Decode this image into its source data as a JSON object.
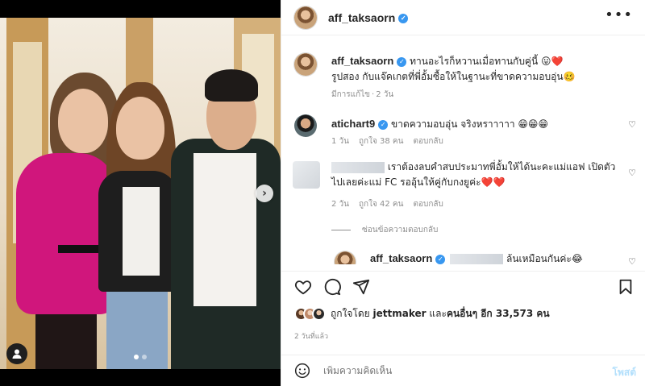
{
  "post": {
    "username": "aff_taksaorn",
    "more_icon": "more-horizontal-icon"
  },
  "caption": {
    "username": "aff_taksaorn",
    "line1": "ทานอะไรก็หวานเมื่อทานกับคู่นี้ 😛❤️",
    "line2": "รูปสอง กับแจ๊คเกตที่พี่อั้มซื้อให้ในฐานะที่ขาดความอบอุ่น🥴",
    "edited": "มีการแก้ไข",
    "time": "2 วัน"
  },
  "comments": [
    {
      "username": "atichart9",
      "text": "ขาดความอบอุ่น จริงหราาาาา 😁😁😁",
      "time": "1 วัน",
      "likes": "ถูกใจ 38 คน",
      "reply": "ตอบกลับ"
    },
    {
      "username": "",
      "text_line1": "เราต้องลบคำสบประมาทพี่อั้มให้ได้นะคะแม่แอฟ เปิดตัว",
      "text_line2": "ไปเลยค่ะแม่ FC รออุ้นให้คู่กับกงยูค่ะ❤️❤️",
      "time": "2 วัน",
      "likes": "ถูกใจ 42 คน",
      "reply": "ตอบกลับ"
    }
  ],
  "hide_replies": "ซ่อนข้อความตอบกลับ",
  "reply": {
    "username": "aff_taksaorn",
    "text": "ล้นเหมือนกันค่ะ😂"
  },
  "likes": {
    "prefix": "ถูกใจโดย",
    "user": "jettmaker",
    "middle": "และ",
    "others": "คนอื่นๆ อีก 33,573 คน"
  },
  "timestamp": "2 วันที่แล้ว",
  "composer": {
    "placeholder": "เพิ่มความคิดเห็น",
    "post": "โพสต์"
  },
  "colors": {
    "verified": "#3897f0",
    "muted": "#8e8e8e",
    "post_disabled": "#b2dffc",
    "heart": "#ed4956"
  }
}
